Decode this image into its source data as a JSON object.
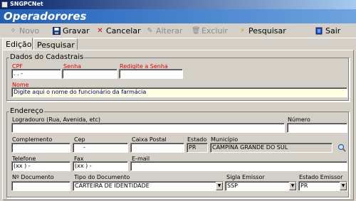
{
  "window": {
    "title": "SNGPCNet"
  },
  "header": {
    "title": "Operadorores"
  },
  "toolbar": {
    "novo": "Novo",
    "gravar": "Gravar",
    "cancelar": "Cancelar",
    "alterar": "Alterar",
    "excluir": "Excluir",
    "pesquisar": "Pesquisar",
    "sair": "Sair"
  },
  "tabs": {
    "edicao": "Edição",
    "pesquisar": "Pesquisar"
  },
  "cadastro": {
    "legend": "Dados do Cadastrais",
    "cpf_label": "CPF",
    "cpf_value": " .  .  -",
    "senha_label": "Senha",
    "redigite_label": "Redigite a Senha",
    "nome_label": "Nome",
    "nome_value": "Digite aqui o nome do funcionário da farmácia"
  },
  "endereco": {
    "legend": "Endereço",
    "logradouro_label": "Logradouro (Rua, Avenida, etc)",
    "numero_label": "Número",
    "complemento_label": "Complemento",
    "cep_label": "Cep",
    "cep_value": "-",
    "caixa_postal_label": "Caixa Postal",
    "estado_label": "Estado",
    "estado_value": "PR",
    "municipio_label": "Município",
    "municipio_value": "CAMPINA GRANDE DO SUL",
    "telefone_label": "Telefone",
    "telefone_value": "(xx )    -",
    "fax_label": "Fax",
    "fax_value": "(xx )    -",
    "email_label": "E-mail",
    "ndoc_label": "Nº Documento",
    "tipo_doc_label": "Tipo do Documento",
    "tipo_doc_value": "CARTEIRA DE IDENTIDADE",
    "sigla_label": "Sigla Emissor",
    "sigla_value": "SSP",
    "estado_emissor_label": "Estado Emissor",
    "estado_emissor_value": "PR"
  },
  "colors": {
    "header_start": "#1f5fb8",
    "header_end": "#6ea4e0",
    "required_label": "#e00000",
    "nome_field_bg": "#ffffe1"
  }
}
